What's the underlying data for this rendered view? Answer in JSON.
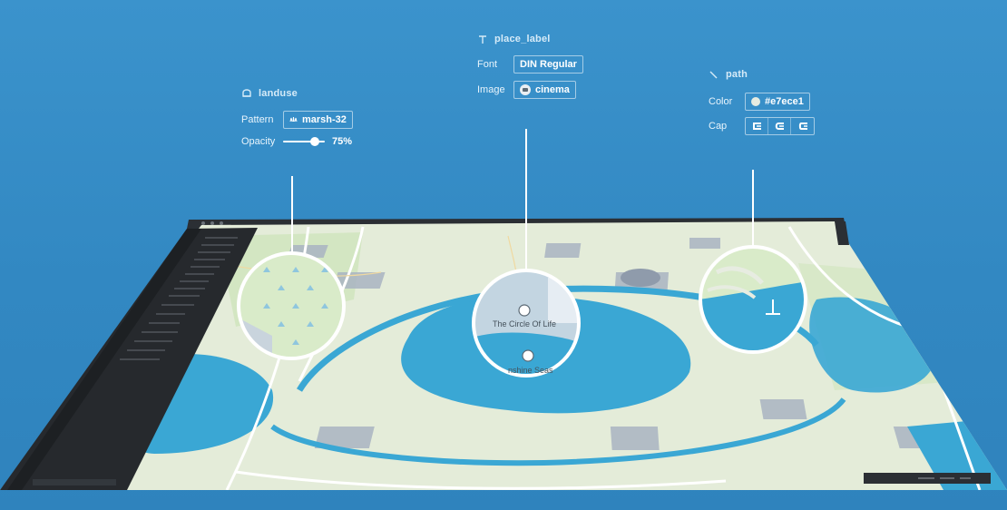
{
  "panels": {
    "landuse": {
      "title": "landuse",
      "icon": "fill-layer-icon",
      "pattern_label": "Pattern",
      "pattern_value": "marsh-32",
      "opacity_label": "Opacity",
      "opacity_value": "75%",
      "opacity_fraction": 0.75
    },
    "place_label": {
      "title": "place_label",
      "icon": "text-layer-icon",
      "font_label": "Font",
      "font_value": "DIN Regular",
      "image_label": "Image",
      "image_value": "cinema"
    },
    "path": {
      "title": "path",
      "icon": "line-layer-icon",
      "color_label": "Color",
      "color_value": "#e7ece1",
      "cap_label": "Cap",
      "cap_options": [
        "butt",
        "round",
        "square"
      ]
    }
  },
  "map": {
    "labels": {
      "circle_of_life": "The Circle Of Life",
      "sunshine_seasons": "nshine Seas"
    }
  },
  "colors": {
    "background": "#3288c2",
    "water": "#3aa7d4",
    "land": "#e4ecd9",
    "park": "#c8e2b4",
    "building": "#a8b3c1",
    "sidebar": "#24272b",
    "path": "#e7ece1"
  }
}
